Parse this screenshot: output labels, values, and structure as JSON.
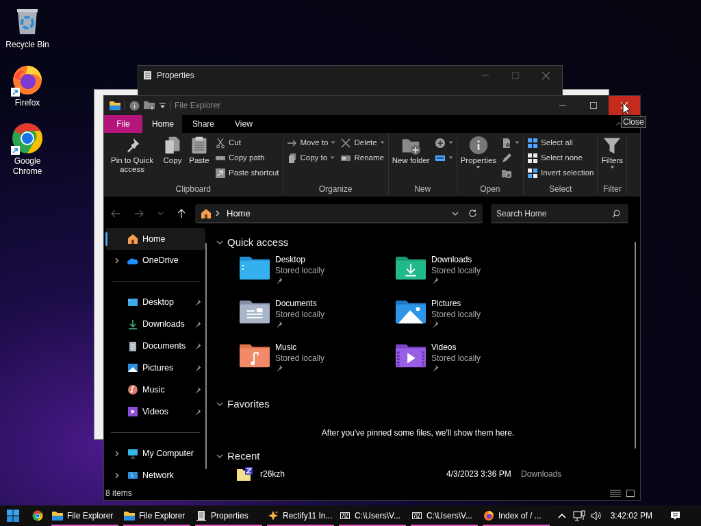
{
  "desktop_icons": [
    {
      "label": "Recycle Bin",
      "kind": "recycle",
      "shortcut": false
    },
    {
      "label": "Firefox",
      "kind": "firefox",
      "shortcut": true
    },
    {
      "label": "Google Chrome",
      "kind": "chrome",
      "shortcut": true
    }
  ],
  "background_window": {
    "title": "Properties"
  },
  "window": {
    "title": "File Explorer",
    "close_tooltip": "Close"
  },
  "ribbon": {
    "tabs": [
      {
        "label": "File",
        "kind": "file",
        "selected": false
      },
      {
        "label": "Home",
        "kind": "tab",
        "selected": true
      },
      {
        "label": "Share",
        "kind": "tab",
        "selected": false
      },
      {
        "label": "View",
        "kind": "tab",
        "selected": false
      }
    ],
    "groups": [
      {
        "name": "Clipboard",
        "columns": [
          [
            {
              "label": "Pin to Quick access",
              "kind": "pin",
              "dropdown": false
            }
          ],
          [
            {
              "label": "Copy",
              "kind": "copy",
              "dropdown": false
            }
          ],
          [
            {
              "label": "Paste",
              "kind": "paste",
              "dropdown": false
            }
          ],
          [
            {
              "label": "Cut",
              "kind": "cut",
              "dropdown": false
            },
            {
              "label": "Copy path",
              "kind": "copypath",
              "dropdown": false
            },
            {
              "label": "Paste shortcut",
              "kind": "shortcut",
              "dropdown": false
            }
          ]
        ]
      },
      {
        "name": "Organize",
        "columns": [
          [
            {
              "label": "Move to",
              "kind": "moveto",
              "dropdown": true
            },
            {
              "label": "Copy to",
              "kind": "copyto",
              "dropdown": true
            }
          ],
          [
            {
              "label": "Delete",
              "kind": "delete",
              "dropdown": true
            },
            {
              "label": "Rename",
              "kind": "rename",
              "dropdown": false
            }
          ]
        ]
      },
      {
        "name": "New",
        "columns": [
          [
            {
              "label": "New folder",
              "kind": "newfolder",
              "dropdown": false
            }
          ],
          [
            {
              "kind": "newitem",
              "dropdown": true
            },
            {
              "kind": "easyaccess",
              "dropdown": true
            }
          ]
        ]
      },
      {
        "name": "Open",
        "columns": [
          [
            {
              "label": "Properties",
              "kind": "properties",
              "dropdown": true
            }
          ],
          [
            {
              "kind": "open",
              "dropdown": true
            },
            {
              "kind": "edit",
              "dropdown": false
            },
            {
              "kind": "history",
              "dropdown": false
            }
          ]
        ]
      },
      {
        "name": "Select",
        "columns": [
          [
            {
              "label": "Select all",
              "kind": "selectall",
              "dropdown": false
            },
            {
              "label": "Select none",
              "kind": "selectnone",
              "dropdown": false
            },
            {
              "label": "Invert selection",
              "kind": "invert",
              "dropdown": false
            }
          ]
        ]
      },
      {
        "name": "Filter",
        "columns": [
          [
            {
              "label": "Filters",
              "kind": "filter",
              "dropdown": true
            }
          ]
        ]
      }
    ]
  },
  "address": {
    "location": "Home",
    "search_placeholder": "Search Home"
  },
  "sidebar": {
    "sections": [
      [
        {
          "label": "Home",
          "kind": "home",
          "selected": true,
          "expandable": false,
          "pinned": false
        },
        {
          "label": "OneDrive",
          "kind": "cloud",
          "selected": false,
          "expandable": true,
          "pinned": false
        }
      ],
      [
        {
          "label": "Desktop",
          "kind": "desktop",
          "selected": false,
          "expandable": false,
          "pinned": true
        },
        {
          "label": "Downloads",
          "kind": "downloads",
          "selected": false,
          "expandable": false,
          "pinned": true
        },
        {
          "label": "Documents",
          "kind": "documents",
          "selected": false,
          "expandable": false,
          "pinned": true
        },
        {
          "label": "Pictures",
          "kind": "pictures",
          "selected": false,
          "expandable": false,
          "pinned": true
        },
        {
          "label": "Music",
          "kind": "music",
          "selected": false,
          "expandable": false,
          "pinned": true
        },
        {
          "label": "Videos",
          "kind": "videos",
          "selected": false,
          "expandable": false,
          "pinned": true
        }
      ],
      [
        {
          "label": "My Computer",
          "kind": "computer",
          "selected": false,
          "expandable": true,
          "pinned": false
        },
        {
          "label": "Network",
          "kind": "network",
          "selected": false,
          "expandable": true,
          "pinned": false
        }
      ]
    ]
  },
  "quick_access": {
    "title": "Quick access",
    "expanded": true,
    "folders": [
      {
        "name": "Desktop",
        "kind": "desktop",
        "status": "Stored locally",
        "pinned": true
      },
      {
        "name": "Downloads",
        "kind": "downloads",
        "status": "Stored locally",
        "pinned": true
      },
      {
        "name": "Documents",
        "kind": "documents",
        "status": "Stored locally",
        "pinned": true
      },
      {
        "name": "Pictures",
        "kind": "pictures",
        "status": "Stored locally",
        "pinned": true
      },
      {
        "name": "Music",
        "kind": "music",
        "status": "Stored locally",
        "pinned": true
      },
      {
        "name": "Videos",
        "kind": "videos",
        "status": "Stored locally",
        "pinned": true
      }
    ]
  },
  "favorites": {
    "title": "Favorites",
    "expanded": true,
    "empty_message": "After you've pinned some files, we'll show them here."
  },
  "recent": {
    "title": "Recent",
    "expanded": true,
    "files": [
      {
        "name": "r26kzh",
        "date": "4/3/2023 3:36 PM",
        "location": "Downloads"
      }
    ]
  },
  "status_bar": {
    "item_count": "8 items"
  },
  "taskbar": {
    "pinned": [
      {
        "kind": "chrome"
      }
    ],
    "buttons": [
      {
        "label": "File Explorer",
        "kind": "folder",
        "open": true
      },
      {
        "label": "File Explorer",
        "kind": "folder",
        "open": true
      },
      {
        "label": "Properties",
        "kind": "props",
        "open": true
      },
      {
        "label": "Rectify11 In...",
        "kind": "sparkle",
        "open": true
      },
      {
        "label": "C:\\Users\\V...",
        "kind": "archive",
        "open": true
      },
      {
        "label": "C:\\Users\\V...",
        "kind": "archive",
        "open": true
      },
      {
        "label": "Index of / ...",
        "kind": "firefox",
        "open": true
      }
    ],
    "clock": "3:42:02 PM"
  }
}
